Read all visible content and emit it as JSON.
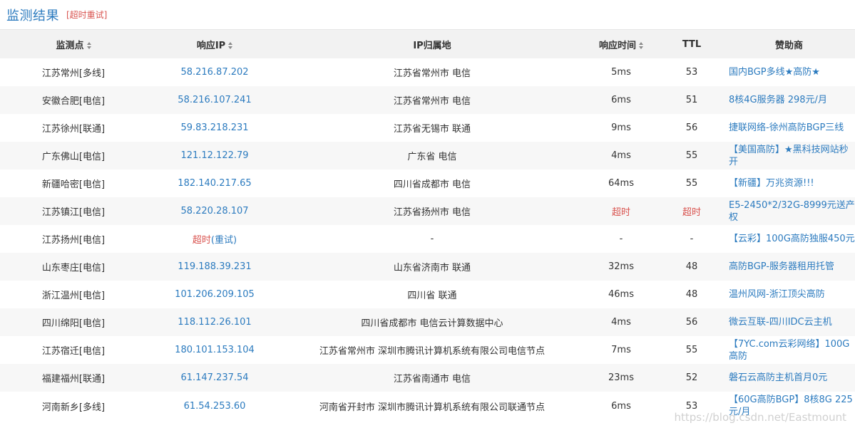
{
  "header": {
    "title": "监测结果",
    "retry_label": "[超时重试]"
  },
  "columns": {
    "location": "监测点",
    "ip": "响应IP",
    "ip_location": "IP归属地",
    "response_time": "响应时间",
    "ttl": "TTL",
    "sponsor": "赞助商"
  },
  "rows": [
    {
      "location": "江苏常州[多线]",
      "ip": "58.216.87.202",
      "ip_location": "江苏省常州市 电信",
      "response_time": "5ms",
      "ttl": "53",
      "sponsor": "国内BGP多线★高防★"
    },
    {
      "location": "安徽合肥[电信]",
      "ip": "58.216.107.241",
      "ip_location": "江苏省常州市 电信",
      "response_time": "6ms",
      "ttl": "51",
      "sponsor": "8核4G服务器 298元/月"
    },
    {
      "location": "江苏徐州[联通]",
      "ip": "59.83.218.231",
      "ip_location": "江苏省无锡市 联通",
      "response_time": "9ms",
      "ttl": "56",
      "sponsor": "捷联网络-徐州高防BGP三线"
    },
    {
      "location": "广东佛山[电信]",
      "ip": "121.12.122.79",
      "ip_location": "广东省 电信",
      "response_time": "4ms",
      "ttl": "55",
      "sponsor": "【美国高防】★黑科技网站秒开"
    },
    {
      "location": "新疆哈密[电信]",
      "ip": "182.140.217.65",
      "ip_location": "四川省成都市 电信",
      "response_time": "64ms",
      "ttl": "55",
      "sponsor": "【新疆】万兆资源!!!"
    },
    {
      "location": "江苏镇江[电信]",
      "ip": "58.220.28.107",
      "ip_location": "江苏省扬州市 电信",
      "response_time": "超时",
      "ttl": "超时",
      "sponsor": "E5-2450*2/32G-8999元送产权",
      "timeout": true
    },
    {
      "location": "江苏扬州[电信]",
      "ip": "超时",
      "ip_retry": "(重试)",
      "ip_location": "-",
      "response_time": "-",
      "ttl": "-",
      "sponsor": "【云彩】100G高防独服450元"
    },
    {
      "location": "山东枣庄[电信]",
      "ip": "119.188.39.231",
      "ip_location": "山东省济南市 联通",
      "response_time": "32ms",
      "ttl": "48",
      "sponsor": "高防BGP-服务器租用托管"
    },
    {
      "location": "浙江温州[电信]",
      "ip": "101.206.209.105",
      "ip_location": "四川省 联通",
      "response_time": "46ms",
      "ttl": "48",
      "sponsor": "温州风网-浙江顶尖高防"
    },
    {
      "location": "四川绵阳[电信]",
      "ip": "118.112.26.101",
      "ip_location": "四川省成都市 电信云计算数据中心",
      "response_time": "4ms",
      "ttl": "56",
      "sponsor": "微云互联-四川IDC云主机"
    },
    {
      "location": "江苏宿迁[电信]",
      "ip": "180.101.153.104",
      "ip_location": "江苏省常州市 深圳市腾讯计算机系统有限公司电信节点",
      "response_time": "7ms",
      "ttl": "55",
      "sponsor": "【7YC.com云彩网络】100G高防"
    },
    {
      "location": "福建福州[联通]",
      "ip": "61.147.237.54",
      "ip_location": "江苏省南通市 电信",
      "response_time": "23ms",
      "ttl": "52",
      "sponsor": "磐石云高防主机首月0元"
    },
    {
      "location": "河南新乡[多线]",
      "ip": "61.54.253.60",
      "ip_location": "河南省开封市 深圳市腾讯计算机系统有限公司联通节点",
      "response_time": "6ms",
      "ttl": "53",
      "sponsor": "【60G高防BGP】8核8G 225元/月"
    }
  ],
  "watermark": "https://blog.csdn.net/Eastmount",
  "colors": {
    "link": "#2c7bbf",
    "timeout": "#d9534f",
    "header_bg": "#f2f2f2",
    "stripe_bg": "#f7f7f7"
  }
}
